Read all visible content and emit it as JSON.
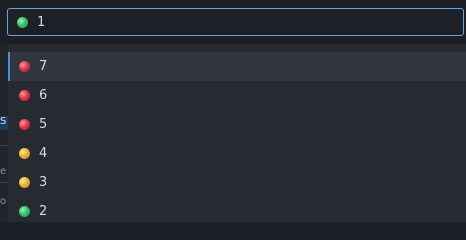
{
  "select": {
    "value": "1",
    "status_color": "green"
  },
  "options": [
    {
      "label": "7",
      "status_color": "red",
      "active": true
    },
    {
      "label": "6",
      "status_color": "red",
      "active": false
    },
    {
      "label": "5",
      "status_color": "red",
      "active": false
    },
    {
      "label": "4",
      "status_color": "yellow",
      "active": false
    },
    {
      "label": "3",
      "status_color": "yellow",
      "active": false
    },
    {
      "label": "2",
      "status_color": "green",
      "active": false
    }
  ],
  "background_fragments": [
    "S",
    "e",
    "o"
  ],
  "colors": {
    "accent": "#4a8fe0",
    "focus_border": "#6f9fd8",
    "green": "#36c36a",
    "red": "#e2374a",
    "yellow": "#e8b533"
  }
}
